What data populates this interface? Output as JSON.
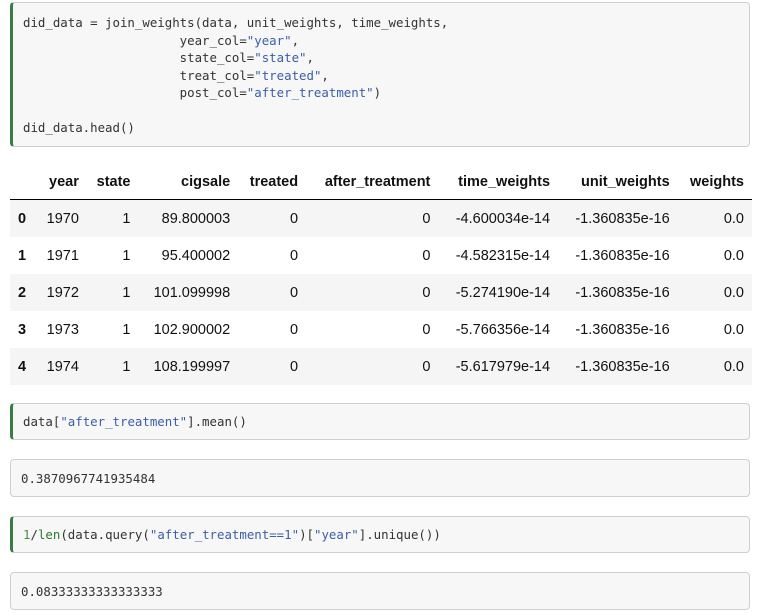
{
  "cells": {
    "join_code": {
      "line1_a": "did_data = join_weights(data, unit_weights, time_weights,",
      "line2_kw": "year_col=",
      "line2_val": "\"year\"",
      "line3_kw": "state_col=",
      "line3_val": "\"state\"",
      "line4_kw": "treat_col=",
      "line4_val": "\"treated\"",
      "line5_kw": "post_col=",
      "line5_val": "\"after_treatment\"",
      "line5_end": ")",
      "line7": "did_data.head()"
    },
    "mean_code": {
      "a": "data[",
      "s": "\"after_treatment\"",
      "b": "].mean()"
    },
    "mean_output": "0.3870967741935484",
    "len_code": {
      "one": "1",
      "slash": "/",
      "len": "len",
      "a": "(data.query(",
      "s1": "\"after_treatment==1\"",
      "b": ")[",
      "s2": "\"year\"",
      "c": "].unique())"
    },
    "len_output": "0.08333333333333333"
  },
  "table": {
    "columns": [
      "",
      "year",
      "state",
      "cigsale",
      "treated",
      "after_treatment",
      "time_weights",
      "unit_weights",
      "weights"
    ],
    "rows": [
      [
        "0",
        "1970",
        "1",
        "89.800003",
        "0",
        "0",
        "-4.600034e-14",
        "-1.360835e-16",
        "0.0"
      ],
      [
        "1",
        "1971",
        "1",
        "95.400002",
        "0",
        "0",
        "-4.582315e-14",
        "-1.360835e-16",
        "0.0"
      ],
      [
        "2",
        "1972",
        "1",
        "101.099998",
        "0",
        "0",
        "-5.274190e-14",
        "-1.360835e-16",
        "0.0"
      ],
      [
        "3",
        "1973",
        "1",
        "102.900002",
        "0",
        "0",
        "-5.766356e-14",
        "-1.360835e-16",
        "0.0"
      ],
      [
        "4",
        "1974",
        "1",
        "108.199997",
        "0",
        "0",
        "-5.617979e-14",
        "-1.360835e-16",
        "0.0"
      ]
    ]
  }
}
